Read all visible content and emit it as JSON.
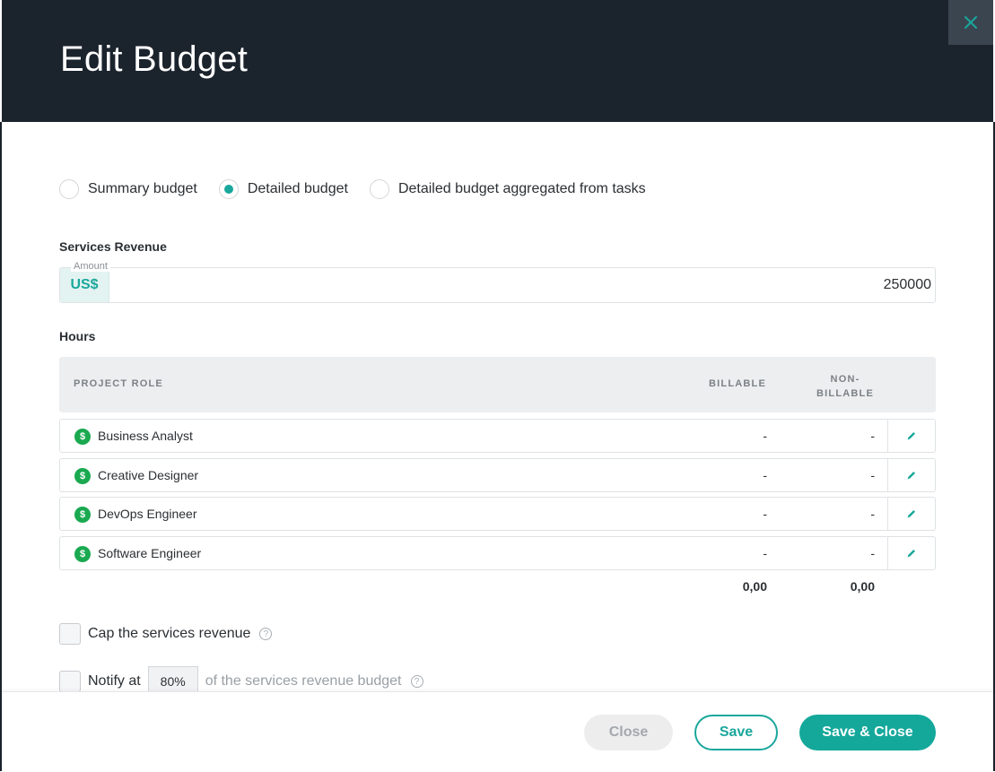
{
  "dialog": {
    "title": "Edit Budget",
    "close_icon": "close-x-icon"
  },
  "budget_type": {
    "options": [
      {
        "label": "Summary budget",
        "checked": false
      },
      {
        "label": "Detailed budget",
        "checked": true
      },
      {
        "label": "Detailed budget aggregated from tasks",
        "checked": false
      }
    ]
  },
  "services_revenue": {
    "label": "Services Revenue",
    "legend": "Amount",
    "currency": "US$",
    "value": "250000"
  },
  "hours": {
    "label": "Hours",
    "columns": {
      "role": "PROJECT ROLE",
      "billable": "BILLABLE",
      "non_billable_1": "NON-",
      "non_billable_2": "BILLABLE"
    },
    "rows": [
      {
        "icon": "$",
        "role": "Business Analyst",
        "billable": "-",
        "non_billable": "-"
      },
      {
        "icon": "$",
        "role": "Creative Designer",
        "billable": "-",
        "non_billable": "-"
      },
      {
        "icon": "$",
        "role": "DevOps Engineer",
        "billable": "-",
        "non_billable": "-"
      },
      {
        "icon": "$",
        "role": "Software Engineer",
        "billable": "-",
        "non_billable": "-"
      }
    ],
    "totals": {
      "billable": "0,00",
      "non_billable": "0,00"
    }
  },
  "options": {
    "cap_label": "Cap the services revenue",
    "notify_label": "Notify at",
    "notify_percent": "80%",
    "notify_suffix": "of the services revenue budget",
    "help_glyph": "?"
  },
  "footer": {
    "close_label": "Close",
    "save_label": "Save",
    "save_close_label": "Save & Close"
  },
  "colors": {
    "header": "#1b232d",
    "accent": "#1aa79c",
    "dollar_badge": "#1aa950"
  }
}
